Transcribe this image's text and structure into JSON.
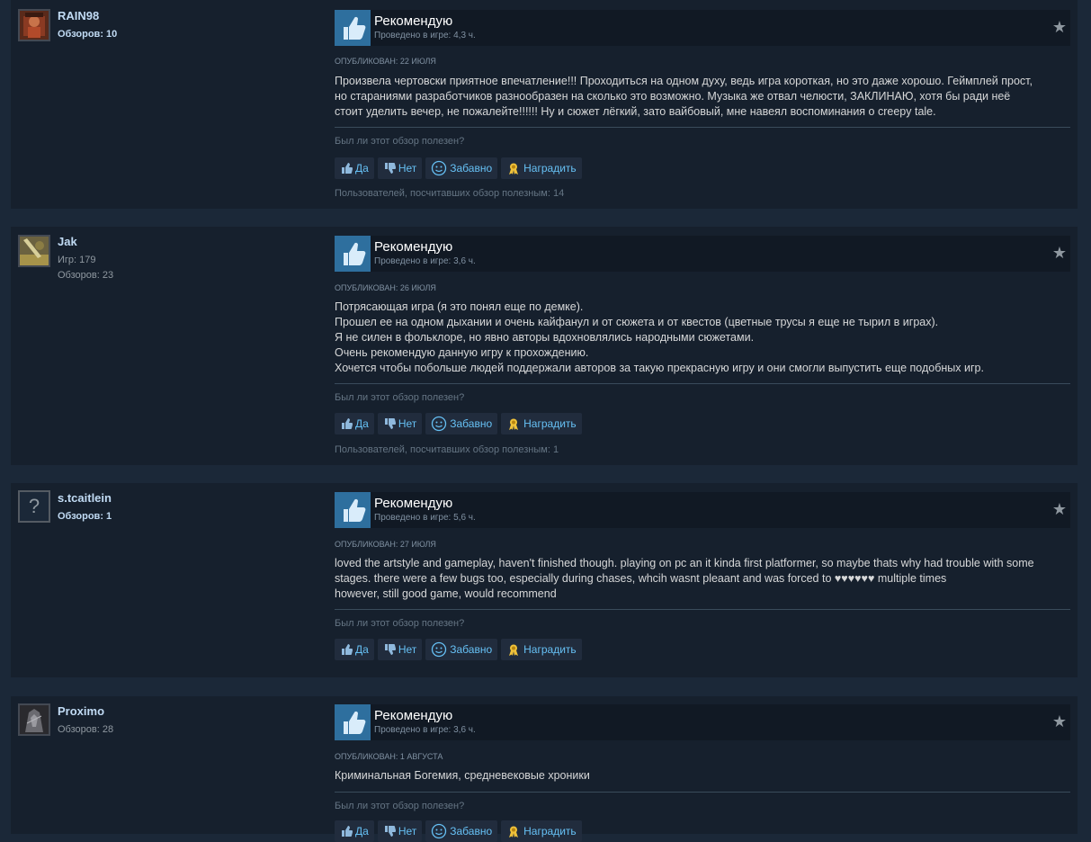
{
  "reviews": [
    {
      "author": "RAIN98",
      "stats": [
        "Обзоров: 10"
      ],
      "recommendation": "Рекомендую",
      "hours": "Проведено в игре: 4,3 ч.",
      "posted": "ОПУБЛИКОВАН: 22 ИЮЛЯ",
      "text_lines": [
        "Произвела чертовски приятное впечатление!!! Проходиться на одном духу, ведь игра короткая, но это даже хорошо. Геймплей прост,",
        "но стараниями разработчиков разнообразен на сколько это возможно. Музыка же отвал челюсти, ЗАКЛИНАЮ, хотя бы ради неё",
        "стоит уделить вечер, не пожалейте!!!!!! Ну и сюжет лёгкий, зато вайбовый, мне навеял воспоминания о creepy tale."
      ],
      "helpful_question": "Был ли этот обзор полезен?",
      "buttons": [
        "Да",
        "Нет",
        "Забавно",
        "Наградить"
      ],
      "helpful_count": "Пользователей, посчитавших обзор полезным: 14"
    },
    {
      "author": "Jak",
      "stats": [
        "Игр: 179",
        "Обзоров: 23"
      ],
      "recommendation": "Рекомендую",
      "hours": "Проведено в игре: 3,6 ч.",
      "posted": "ОПУБЛИКОВАН: 26 ИЮЛЯ",
      "text_lines": [
        "Потрясающая игра (я это понял еще по демке).",
        "Прошел ее на одном дыхании и очень кайфанул и от сюжета и от квестов (цветные трусы я еще не тырил в играх).",
        "Я не силен в фольклоре, но явно авторы вдохновлялись народными сюжетами.",
        "Очень рекомендую данную игру к прохождению.",
        "Хочется чтобы побольше людей поддержали авторов за такую прекрасную игру и они смогли выпустить еще подобных игр."
      ],
      "helpful_question": "Был ли этот обзор полезен?",
      "buttons": [
        "Да",
        "Нет",
        "Забавно",
        "Наградить"
      ],
      "helpful_count": "Пользователей, посчитавших обзор полезным: 1"
    },
    {
      "author": "s.tcaitlein",
      "stats": [
        "Обзоров: 1"
      ],
      "recommendation": "Рекомендую",
      "hours": "Проведено в игре: 5,6 ч.",
      "posted": "ОПУБЛИКОВАН: 27 ИЮЛЯ",
      "text_lines": [
        "loved the artstyle and gameplay, haven't finished though. playing on pc an it kinda first platformer, so maybe thats why had trouble with some",
        "stages. there were a few bugs too, especially during chases, whcih wasnt pleaant and was forced to ♥♥♥♥♥♥ multiple times",
        "however, still good game, would recommend"
      ],
      "helpful_question": "Был ли этот обзор полезен?",
      "buttons": [
        "Да",
        "Нет",
        "Забавно",
        "Наградить"
      ],
      "helpful_count": ""
    },
    {
      "author": "Proximo",
      "stats": [
        "Обзоров: 28"
      ],
      "recommendation": "Рекомендую",
      "hours": "Проведено в игре: 3,6 ч.",
      "posted": "ОПУБЛИКОВАН: 1 АВГУСТА",
      "text_lines": [
        "Криминальная Богемия, средневековые хроники"
      ],
      "helpful_question": "Был ли этот обзор полезен?",
      "buttons": [
        "Да",
        "Нет",
        "Забавно",
        "Наградить"
      ],
      "helpful_count": ""
    }
  ],
  "icons": {
    "recommend": "thumbs-up-icon",
    "favorite": "star-icon",
    "yes": "thumbs-up-icon",
    "no": "thumbs-down-icon",
    "funny": "smiley-icon",
    "award": "award-icon",
    "unknown_avatar": "?"
  },
  "colors": {
    "page_bg": "#1b2838",
    "card_bg": "#16202d",
    "thumb_bg": "#2e6f9e",
    "link": "#66c0f4",
    "author": "#c1dbf4"
  }
}
